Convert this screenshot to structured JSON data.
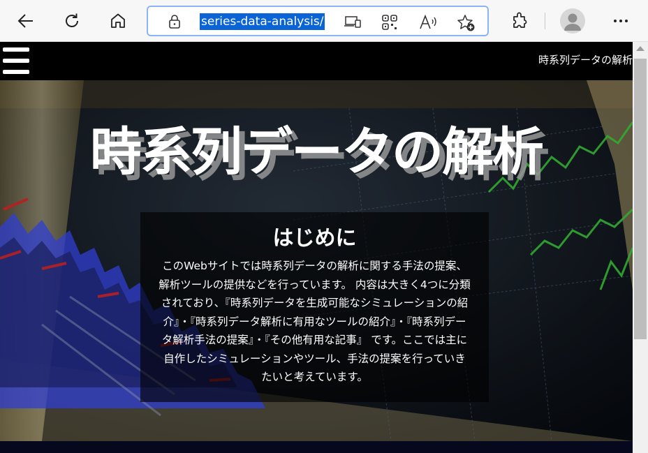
{
  "browser": {
    "address_url": "series-data-analysis/",
    "buttons": {
      "back": "back-arrow-icon",
      "refresh": "refresh-icon",
      "home": "home-icon",
      "site_info": "lock-icon",
      "app_available": "app-available-icon",
      "qr": "qr-code-icon",
      "read_aloud": "read-aloud-icon",
      "favorites": "add-favorite-icon",
      "extensions": "extensions-icon",
      "profile": "profile-avatar",
      "more": "more-menu-icon"
    },
    "highlight_color": "#0a64d6",
    "address_border_color": "#8ab4f8"
  },
  "page": {
    "header_title": "時系列データの解析",
    "hero_title": "時系列データの解析",
    "intro": {
      "heading": "はじめに",
      "body": "このWebサイトでは時系列データの解析に関する手法の提案、解析ツールの提供などを行っています。 内容は大きく4つに分類されており、『時系列データを生成可能なシミュレーションの紹介』・『時系列データ解析に有用なツールの紹介』・『時系列データ解析手法の提案』・『その他有用な記事』 です。ここでは主に自作したシミュレーションやツール、手法の提案を行っていきたいと考えています。"
    },
    "colors": {
      "header_bg": "#000000",
      "bottom_band": "#06081e",
      "chart_blue": "#3b4cff",
      "chart_red": "#e02828",
      "chart_green": "#3ccf3c"
    }
  }
}
